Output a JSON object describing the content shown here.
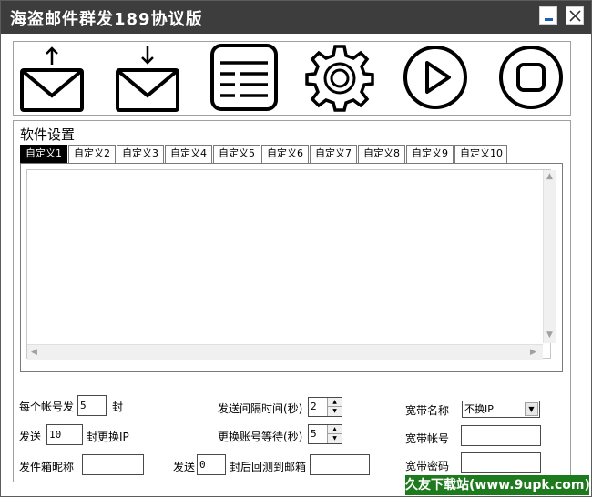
{
  "window": {
    "title": "海盗邮件群发189协议版"
  },
  "toolbar": {
    "buttons": [
      {
        "name": "import-mail-button",
        "icon": "mail-upload-icon"
      },
      {
        "name": "export-mail-button",
        "icon": "mail-download-icon"
      },
      {
        "name": "list-button",
        "icon": "list-icon"
      },
      {
        "name": "settings-button",
        "icon": "gear-icon"
      },
      {
        "name": "start-button",
        "icon": "play-icon"
      },
      {
        "name": "stop-button",
        "icon": "stop-icon"
      }
    ]
  },
  "settings": {
    "title": "软件设置",
    "tabs": [
      "自定义1",
      "自定义2",
      "自定义3",
      "自定义4",
      "自定义5",
      "自定义6",
      "自定义7",
      "自定义8",
      "自定义9",
      "自定义10"
    ],
    "active_tab": 0,
    "editor_content": ""
  },
  "form": {
    "per_account_label": "每个帐号发",
    "per_account_value": "5",
    "per_account_unit": "封",
    "send_label": "发送",
    "send_value": "10",
    "change_ip_label": "封更换IP",
    "sender_nickname_label": "发件箱昵称",
    "sender_nickname_value": "",
    "interval_label": "发送间隔时间(秒)",
    "interval_value": "2",
    "switch_wait_label": "更换账号等待(秒)",
    "switch_wait_value": "5",
    "send2_label": "发送",
    "send2_value": "0",
    "test_label": "封后回测到邮箱",
    "test_email_value": "",
    "broadband_name_label": "宽带名称",
    "broadband_name_value": "不换IP",
    "broadband_account_label": "宽带帐号",
    "broadband_account_value": "",
    "broadband_password_label": "宽带密码",
    "broadband_password_value": ""
  },
  "watermark": "久友下载站(www.9upk.com)",
  "colors": {
    "titlebar": "#3d3d3d",
    "active_tab": "#000000",
    "watermark": "#1d7a1d"
  }
}
